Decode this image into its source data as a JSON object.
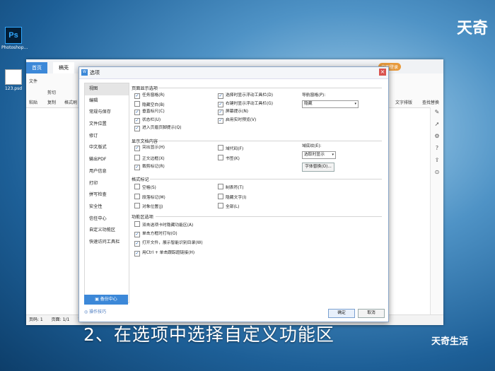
{
  "desktop": {
    "icons": [
      {
        "label": "Photoshop..."
      },
      {
        "label": "123.psd"
      }
    ],
    "brand": "天奇"
  },
  "wps": {
    "tabs": [
      "首页",
      "稿壳"
    ],
    "ribbon": {
      "labels": [
        "文件",
        "剪切",
        "复制",
        "格式刷",
        "粘贴"
      ],
      "right_labels": [
        "文字排版",
        "查找替换"
      ]
    },
    "status": {
      "page": "页码: 1",
      "pages": "页面: 1/1",
      "section": "节"
    },
    "login_badge": "立即登录"
  },
  "dialog": {
    "title": "选项",
    "nav": [
      "视图",
      "编辑",
      "常规与保存",
      "文件位置",
      "修订",
      "中文版式",
      "输出PDF",
      "用户信息",
      "打印",
      "拼写检查",
      "安全性",
      "信任中心",
      "自定义功能区",
      "快速访问工具栏"
    ],
    "nav_selected": 0,
    "backup": "备份中心",
    "tips": "操作技巧",
    "sections": {
      "page_display": "页面显示选项",
      "doc_content": "显示文档内容",
      "format_marks": "格式标记",
      "func_options": "功能区选项"
    },
    "page_display_left": [
      {
        "label": "任务窗格(R)",
        "checked": true
      },
      {
        "label": "隐藏空白(B)",
        "checked": false
      },
      {
        "label": "垂直标尺(C)",
        "checked": true
      },
      {
        "label": "状态栏(U)",
        "checked": true
      },
      {
        "label": "进入页眉页脚提示(Q)",
        "checked": true
      }
    ],
    "page_display_right": [
      {
        "label": "选择时显示浮动工具栏(D)",
        "checked": true
      },
      {
        "label": "右键时显示浮动工具栏(G)",
        "checked": true
      },
      {
        "label": "屏幕提示(N)",
        "checked": true
      },
      {
        "label": "启用实时预览(V)",
        "checked": true
      }
    ],
    "nav_pane_label": "导航窗格(P):",
    "nav_pane_value": "隐藏",
    "doc_left": [
      {
        "label": "突出显示(H)",
        "checked": true
      },
      {
        "label": "正文边框(X)",
        "checked": false
      },
      {
        "label": "裁剪标记(R)",
        "checked": true
      }
    ],
    "doc_right": [
      {
        "label": "域代码(F)",
        "checked": false
      },
      {
        "label": "书签(K)",
        "checked": false
      }
    ],
    "field_shading_label": "域底纹(E):",
    "field_shading_value": "选取时显示",
    "font_replace": "字体替换(O)...",
    "format_left": [
      {
        "label": "空格(S)",
        "checked": false
      },
      {
        "label": "段落标记(M)",
        "checked": false
      },
      {
        "label": "对象位置(J)",
        "checked": false
      }
    ],
    "format_right": [
      {
        "label": "制表符(T)",
        "checked": false
      },
      {
        "label": "隐藏文字(I)",
        "checked": false
      },
      {
        "label": "全部(L)",
        "checked": false
      }
    ],
    "func_items": [
      {
        "label": "双击选项卡时隐藏功能区(A)",
        "checked": false
      },
      {
        "label": "单击方框时打勾(O)",
        "checked": true
      },
      {
        "label": "打开文件，展示智能识别目录(W)",
        "checked": true
      },
      {
        "label": "用Ctrl + 单击跟踪超链接(H)",
        "checked": true
      }
    ],
    "ok": "确定",
    "cancel": "取消"
  },
  "caption": "2、在选项中选择自定义功能区",
  "watermark": "天奇生活"
}
